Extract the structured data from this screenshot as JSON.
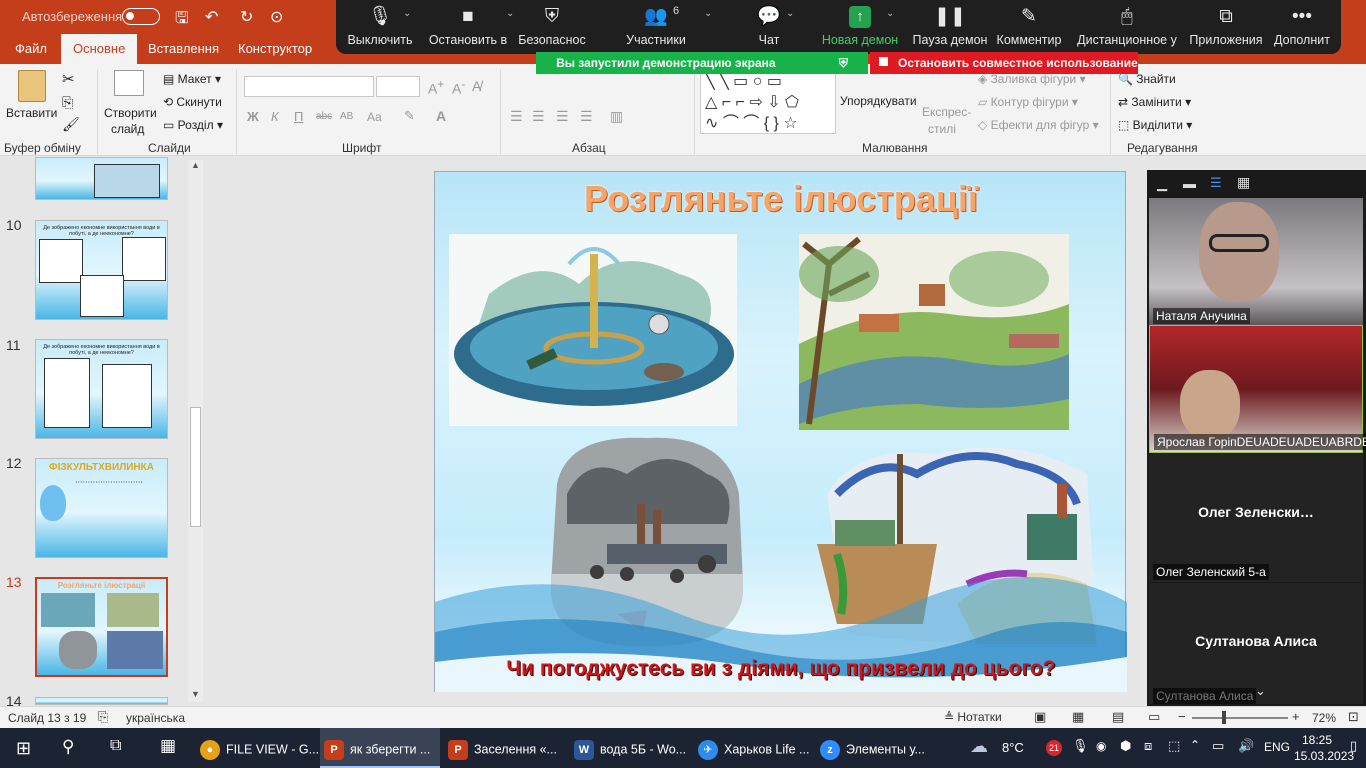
{
  "titlebar": {
    "autosave_label": "Автозбереження"
  },
  "tabs": [
    {
      "label": "Файл"
    },
    {
      "label": "Основне"
    },
    {
      "label": "Вставлення"
    },
    {
      "label": "Конструктор"
    }
  ],
  "ribbon": {
    "paste": "Вставити",
    "clipboard_label": "Буфер обміну",
    "new_slide": "Створити",
    "new_slide2": "слайд",
    "layout": "Макет",
    "reset": "Скинути",
    "section": "Розділ",
    "slides_label": "Слайди",
    "font_label": "Шрифт",
    "paragraph_label": "Абзац",
    "arrange": "Упорядкувати",
    "quick_styles": "Експрес-",
    "quick_styles2": "стилі",
    "shape_fill": "Заливка фігури",
    "shape_outline": "Контур фігури",
    "shape_effects": "Ефекти для фігур",
    "drawing_label": "Малювання",
    "find": "Знайти",
    "replace": "Замінити",
    "select": "Виділити",
    "editing_label": "Редагування",
    "font_buttons": [
      "Ж",
      "К",
      "П",
      "abc",
      "AB",
      "Aa"
    ]
  },
  "zoom": {
    "items": [
      {
        "label": "Выключить",
        "icon": "🎙"
      },
      {
        "label": "Остановить в",
        "icon": "■"
      },
      {
        "label": "Безопаснос",
        "icon": "⛨"
      },
      {
        "label": "Участники",
        "icon": "👥"
      },
      {
        "label": "Чат",
        "icon": "💬"
      },
      {
        "label": "Новая демон",
        "icon": "↑"
      },
      {
        "label": "Пауза демон",
        "icon": "❚❚"
      },
      {
        "label": "Комментир",
        "icon": "✎"
      },
      {
        "label": "Дистанционное у",
        "icon": "🖱"
      },
      {
        "label": "Приложения",
        "icon": "⧉"
      },
      {
        "label": "Дополнит",
        "icon": "•••"
      }
    ],
    "participants_count": "6",
    "share_banner": "Вы запустили демонстрацию экрана",
    "stop_share": "Остановить совместное использование"
  },
  "thumbnails": [
    {
      "num": "10",
      "text": "Де зображено економне використання води в побуті, а де неекономне?"
    },
    {
      "num": "11",
      "text": "Де зображено економне використання води в побуті, а де неекономне?"
    },
    {
      "num": "12",
      "text": "ФІЗКУЛЬТХВИЛИНКА"
    },
    {
      "num": "13",
      "text": "Розгляньте ілюстрації"
    },
    {
      "num": "14",
      "text": ""
    }
  ],
  "slide": {
    "title": "Розгляньте ілюстрації",
    "question": "Чи погоджуєтесь ви з діями, що призвели до цього?"
  },
  "participants": [
    {
      "name": "Наталя Анучина",
      "big": ""
    },
    {
      "name": "Ярослав ГоріпDEUADEUADEUABRDEUA❤",
      "big": ""
    },
    {
      "name": "Олег Зеленский 5-а",
      "big": "Олег  Зеленски…"
    },
    {
      "name": "Султанова Алиса",
      "big": "Султанова Алиса"
    }
  ],
  "status": {
    "slide_info": "Слайд 13 з 19",
    "language": "українська",
    "notes": "Нотатки",
    "zoom_level": "72%"
  },
  "taskbar": {
    "items": [
      {
        "label": "FILE VIEW - G...",
        "color": "#e6a117",
        "glyph": "●"
      },
      {
        "label": "як зберегти ...",
        "color": "#c43e1c",
        "glyph": "P"
      },
      {
        "label": "Заселення «...",
        "color": "#c43e1c",
        "glyph": "P"
      },
      {
        "label": "вода 5Б - Wo...",
        "color": "#2b5797",
        "glyph": "W"
      },
      {
        "label": "Харьков Life ...",
        "color": "#2d8ceb",
        "glyph": "✈"
      },
      {
        "label": "Элементы у...",
        "color": "#2d8cff",
        "glyph": "z"
      }
    ],
    "weather": "8°C",
    "badge": "21",
    "lang": "ENG",
    "time": "18:25",
    "date": "15.03.2023"
  }
}
